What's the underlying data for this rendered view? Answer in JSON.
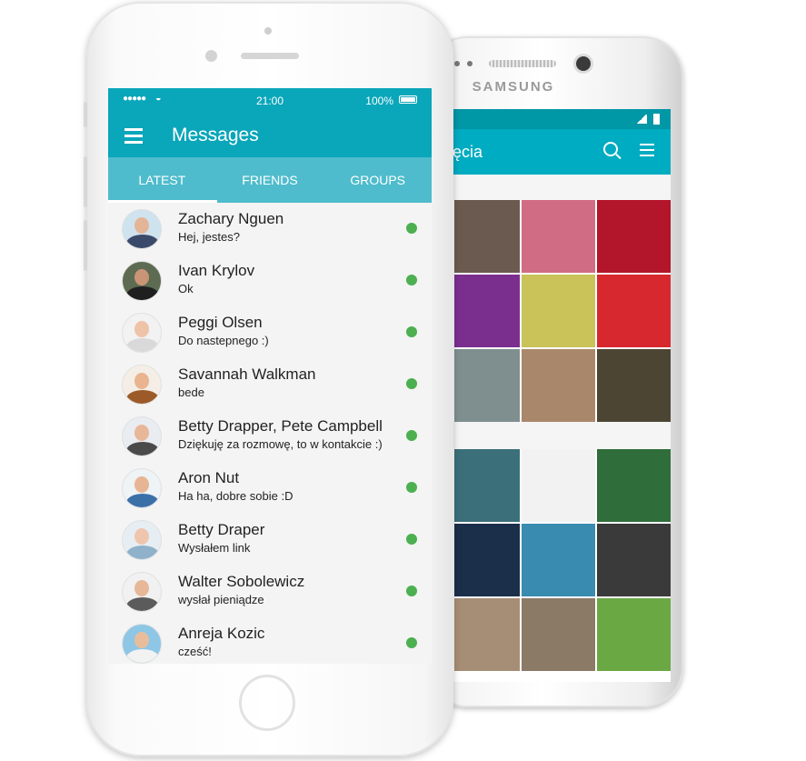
{
  "samsung": {
    "brand": "SAMSUNG",
    "app_title": "ęcia",
    "gallery_tiles_row1": [
      "#6b5a4f",
      "#d06c84",
      "#b3152b",
      "#7a2f8f",
      "#c9c35a",
      "#d8282f",
      "#7f8f90",
      "#a9876a",
      "#4d4534"
    ],
    "gallery_tiles_row2": [
      "#3b6f7a",
      "#f2f2f2",
      "#2f6e3a",
      "#1b2f4a",
      "#3a8bb0",
      "#3a3a3a",
      "#a68e76",
      "#8b7a66",
      "#6aa843"
    ]
  },
  "iphone": {
    "status": {
      "signal_dots": "●●●●●",
      "time": "21:00",
      "battery": "100%"
    },
    "app_title": "Messages",
    "tabs": [
      {
        "label": "LATEST",
        "active": true
      },
      {
        "label": "FRIENDS",
        "active": false
      },
      {
        "label": "GROUPS",
        "active": false
      }
    ],
    "messages": [
      {
        "name": "Zachary Nguen",
        "text": "Hej, jestes?",
        "online": true,
        "skin": "#e3b596",
        "shirt": "#3a4a6a",
        "bg": "#cfe3ef"
      },
      {
        "name": "Ivan Krylov",
        "text": "Ok",
        "online": true,
        "skin": "#c99576",
        "shirt": "#1f1f1f",
        "bg": "#5d6b52"
      },
      {
        "name": "Peggi Olsen",
        "text": "Do nastepnego :)",
        "online": true,
        "skin": "#efc3a8",
        "shirt": "#d9d9d9",
        "bg": "#f2f2f2"
      },
      {
        "name": "Savannah Walkman",
        "text": "bede",
        "online": true,
        "skin": "#e9b48f",
        "shirt": "#9b5a28",
        "bg": "#f4eee6"
      },
      {
        "name": "Betty Drapper, Pete Campbell",
        "text": "Dziękuję za rozmowę, to w kontakcie :)",
        "online": true,
        "skin": "#e8b799",
        "shirt": "#4a4a4a",
        "bg": "#e9edf1"
      },
      {
        "name": "Aron Nut",
        "text": "Ha ha, dobre sobie :D",
        "online": true,
        "skin": "#e7b594",
        "shirt": "#3b6fa8",
        "bg": "#eef3f6"
      },
      {
        "name": "Betty Draper",
        "text": "Wysłałem link",
        "online": true,
        "skin": "#efc6ad",
        "shirt": "#8fb1c9",
        "bg": "#e6eef3"
      },
      {
        "name": "Walter Sobolewicz",
        "text": "wysłał pieniądze",
        "online": true,
        "skin": "#e6b898",
        "shirt": "#5b5b5b",
        "bg": "#f1f1f1"
      },
      {
        "name": "Anreja Kozic",
        "text": "cześć!",
        "online": true,
        "skin": "#e9bd9c",
        "shirt": "#f2f2f2",
        "bg": "#8ec6e6"
      }
    ],
    "colors": {
      "appbar": "#0aa6ba",
      "tabs": "#4ebccc",
      "online": "#4caf50"
    }
  }
}
